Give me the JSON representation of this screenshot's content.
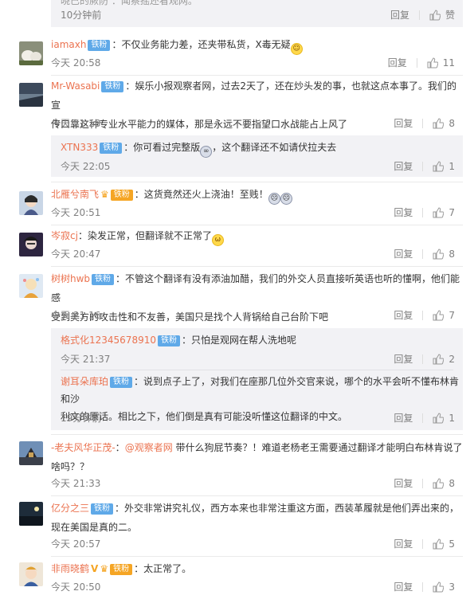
{
  "top_partial": {
    "text": "晓已的厥防 ：闻察摇还看观网。",
    "time": "10分钟前",
    "reply": "回复",
    "like": "赞"
  },
  "comments": [
    {
      "user": "iamaxh",
      "badge": "铁粉",
      "text": "：不仅业务能力差，还夹带私货，X毒无疑",
      "time": "今天 20:58",
      "reply": "回复",
      "likes": "11"
    },
    {
      "user": "Mr-Wasabi",
      "badge": "铁粉",
      "text_line1": "：娱乐小报观察者网，过去2天了，还在炒头发的事，也就这点本事了。我们的宣",
      "text_line2": "传口靠这种专业水平能力的媒体，那是永远不要指望口水战能占上风了",
      "time": "今天 21:18",
      "reply": "回复",
      "likes": "8",
      "sub": {
        "user": "XTN333",
        "badge": "铁粉",
        "text": "：你可看过完整版",
        "text_after": "，这个翻译还不如请伏拉夫去",
        "time": "今天 22:05",
        "reply": "回复",
        "likes": "1"
      }
    },
    {
      "user": "北雁兮南飞",
      "badge": "铁粉",
      "text": "：这货竟然还火上浇油！至贱！",
      "time": "今天 20:51",
      "reply": "回复",
      "likes": "7"
    },
    {
      "user": "岑寂cj",
      "text": "：染发正常，但翻译就不正常了",
      "time": "今天 20:47",
      "reply": "回复",
      "likes": "8"
    },
    {
      "user": "树树hwb",
      "badge": "铁粉",
      "text_line1": "：不管这个翻译有没有添油加醋，我们的外交人员直接听英语也听的懂啊，他们能感",
      "text_line2": "受到美方的攻击性和不友善，美国只是找个人背锅给自己台阶下吧",
      "time": "今天 21:16",
      "reply": "回复",
      "likes": "7",
      "subs": [
        {
          "user": "格式化12345678910",
          "badge": "铁粉",
          "text": "：只怕是观网在帮人洗地呢",
          "time": "今天 21:37",
          "reply": "回复",
          "likes": "2"
        },
        {
          "user": "谢耳朵库珀",
          "badge": "铁粉",
          "text_line1": "：说到点子上了，对我们在座那几位外交官来说，哪个的水平会听不懂布林肯和沙",
          "text_line2": "利文的原话。相比之下，他们倒是真有可能没听懂这位翻译的中文。",
          "time": "19分钟前",
          "reply": "回复",
          "likes": "1"
        }
      ]
    },
    {
      "user": "-老夫风华正茂-",
      "mention": "@观察者网",
      "text_line1": " 带什么狗屁节奏？！难道老杨老王需要通过翻译才能明白布林肯说了",
      "text_line2": "啥吗？？",
      "time": "今天 21:33",
      "reply": "回复",
      "likes": "8"
    },
    {
      "user": "亿分之三",
      "badge": "铁粉",
      "text_line1": "：外交非常讲究礼仪，西方本来也非常注重这方面，西装革履就是他们弄出来的，",
      "text_line2": "现在美国是真的二。",
      "time": "今天 20:57",
      "reply": "回复",
      "likes": "5"
    },
    {
      "user": "非雨晓鹤",
      "badge": "铁粉",
      "text": "：太正常了。",
      "time": "今天 20:50",
      "reply": "回复",
      "likes": "3"
    }
  ],
  "colors": {
    "username": "#eb7350",
    "meta": "#808080",
    "badge": "#5fa9e8",
    "subbox": "#f2f2f5"
  }
}
